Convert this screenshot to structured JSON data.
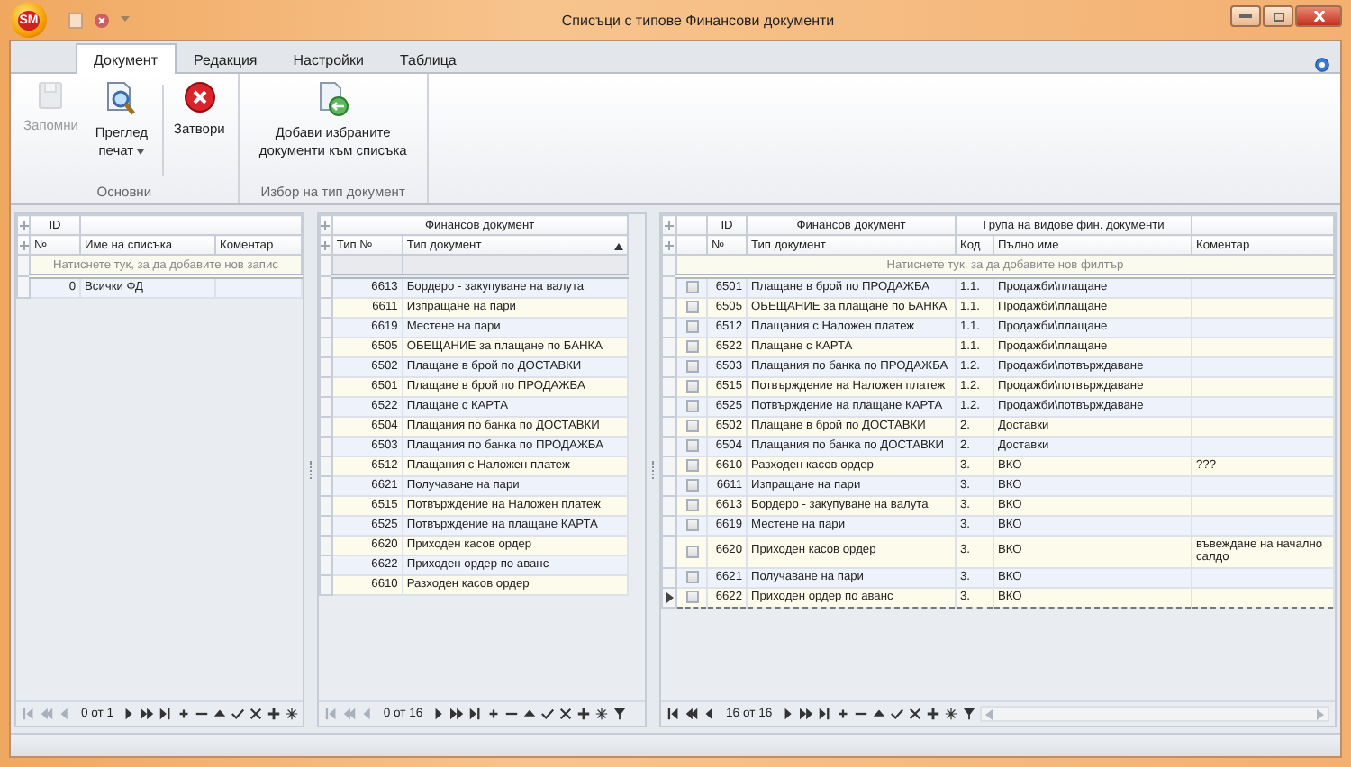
{
  "window": {
    "title": "Списъци с типове Финансови документи",
    "app_logo": "SM"
  },
  "ribbon": {
    "tabs": [
      {
        "label": "Документ",
        "selected": true
      },
      {
        "label": "Редакция",
        "selected": false
      },
      {
        "label": "Настройки",
        "selected": false
      },
      {
        "label": "Таблица",
        "selected": false
      }
    ],
    "groups": [
      {
        "label": "Основни",
        "buttons": [
          {
            "kind": "save",
            "label": "Запомни",
            "disabled": true,
            "dropdown": false
          },
          {
            "kind": "preview",
            "label": "Преглед печат",
            "disabled": false,
            "dropdown": true
          },
          {
            "kind": "close",
            "label": "Затвори",
            "disabled": false,
            "dropdown": false
          }
        ]
      },
      {
        "label": "Избор на тип документ",
        "buttons": [
          {
            "kind": "add",
            "label": "Добави избраните документи към списъка",
            "disabled": false,
            "dropdown": false
          }
        ]
      }
    ]
  },
  "lists_grid": {
    "bands": [
      {
        "label": "ID"
      }
    ],
    "columns": [
      {
        "label": "№"
      },
      {
        "label": "Име на списъка"
      },
      {
        "label": "Коментар"
      }
    ],
    "new_row_hint": "Натиснете тук, за да добавите нов запис",
    "rows": [
      {
        "cells": [
          "0",
          "Всички ФД"
        ]
      }
    ],
    "position": "0 от 1"
  },
  "types_grid": {
    "bands": [
      {
        "label": "Финансов документ"
      }
    ],
    "columns": [
      {
        "label": "Тип №",
        "sorted": false
      },
      {
        "label": "Тип документ",
        "sorted": true
      }
    ],
    "rows": [
      {
        "cells": [
          "6613",
          "Бордеро - закупуване на валута"
        ]
      },
      {
        "cells": [
          "6611",
          "Изпращане на пари"
        ]
      },
      {
        "cells": [
          "6619",
          "Местене на пари"
        ]
      },
      {
        "cells": [
          "6505",
          "ОБЕЩАНИЕ за плащане по БАНКА"
        ]
      },
      {
        "cells": [
          "6502",
          "Плащане в брой по ДОСТАВКИ"
        ]
      },
      {
        "cells": [
          "6501",
          "Плащане в брой по ПРОДАЖБА"
        ]
      },
      {
        "cells": [
          "6522",
          "Плащане с КАРТА"
        ]
      },
      {
        "cells": [
          "6504",
          "Плащания по банка по ДОСТАВКИ"
        ]
      },
      {
        "cells": [
          "6503",
          "Плащания по банка по ПРОДАЖБА"
        ]
      },
      {
        "cells": [
          "6512",
          "Плащания с Наложен платеж"
        ]
      },
      {
        "cells": [
          "6621",
          "Получаване на пари"
        ]
      },
      {
        "cells": [
          "6515",
          "Потвърждение на Наложен платеж"
        ]
      },
      {
        "cells": [
          "6525",
          "Потвърждение на плащане КАРТА"
        ]
      },
      {
        "cells": [
          "6620",
          "Приходен касов ордер"
        ]
      },
      {
        "cells": [
          "6622",
          "Приходен ордер по аванс"
        ]
      },
      {
        "cells": [
          "6610",
          "Разходен касов ордер"
        ]
      }
    ],
    "position": "0 от 16"
  },
  "selected_grid": {
    "bands": [
      {
        "label": "ID"
      },
      {
        "label": "Финансов документ"
      },
      {
        "label": "Група на видове фин. документи"
      }
    ],
    "columns": [
      {
        "label": "№"
      },
      {
        "label": "Тип документ"
      },
      {
        "label": "Код"
      },
      {
        "label": "Пълно име"
      },
      {
        "label": "Коментар"
      }
    ],
    "filter_hint": "Натиснете тук, за да добавите нов филтър",
    "rows": [
      {
        "checked": false,
        "selected": false,
        "cells": [
          "6501",
          "Плащане в брой по ПРОДАЖБА",
          "1.1.",
          "Продажби\\плащане"
        ]
      },
      {
        "checked": false,
        "selected": false,
        "cells": [
          "6505",
          "ОБЕЩАНИЕ за плащане по БАНКА",
          "1.1.",
          "Продажби\\плащане"
        ]
      },
      {
        "checked": false,
        "selected": false,
        "cells": [
          "6512",
          "Плащания с Наложен платеж",
          "1.1.",
          "Продажби\\плащане"
        ]
      },
      {
        "checked": false,
        "selected": false,
        "cells": [
          "6522",
          "Плащане с КАРТА",
          "1.1.",
          "Продажби\\плащане"
        ]
      },
      {
        "checked": false,
        "selected": false,
        "cells": [
          "6503",
          "Плащания по банка по ПРОДАЖБА",
          "1.2.",
          "Продажби\\потвърждаване"
        ]
      },
      {
        "checked": false,
        "selected": false,
        "cells": [
          "6515",
          "Потвърждение на Наложен платеж",
          "1.2.",
          "Продажби\\потвърждаване"
        ]
      },
      {
        "checked": false,
        "selected": false,
        "cells": [
          "6525",
          "Потвърждение на плащане КАРТА",
          "1.2.",
          "Продажби\\потвърждаване"
        ]
      },
      {
        "checked": false,
        "selected": false,
        "cells": [
          "6502",
          "Плащане в брой по ДОСТАВКИ",
          "2.",
          "Доставки"
        ]
      },
      {
        "checked": false,
        "selected": false,
        "cells": [
          "6504",
          "Плащания по банка по ДОСТАВКИ",
          "2.",
          "Доставки"
        ]
      },
      {
        "checked": false,
        "selected": false,
        "cells": [
          "6610",
          "Разходен касов ордер",
          "3.",
          "ВКО",
          "???"
        ]
      },
      {
        "checked": false,
        "selected": false,
        "cells": [
          "6611",
          "Изпращане на пари",
          "3.",
          "ВКО"
        ]
      },
      {
        "checked": false,
        "selected": false,
        "cells": [
          "6613",
          "Бордеро - закупуване на валута",
          "3.",
          "ВКО"
        ]
      },
      {
        "checked": false,
        "selected": false,
        "cells": [
          "6619",
          "Местене на пари",
          "3.",
          "ВКО"
        ]
      },
      {
        "checked": false,
        "selected": false,
        "cells": [
          "6620",
          "Приходен касов ордер",
          "3.",
          "ВКО",
          "въвеждане на начално салдо"
        ]
      },
      {
        "checked": false,
        "selected": false,
        "cells": [
          "6621",
          "Получаване на пари",
          "3.",
          "ВКО"
        ]
      },
      {
        "checked": false,
        "selected": true,
        "cells": [
          "6622",
          "Приходен ордер по аванс",
          "3.",
          "ВКО"
        ]
      }
    ],
    "position": "16 от 16"
  }
}
